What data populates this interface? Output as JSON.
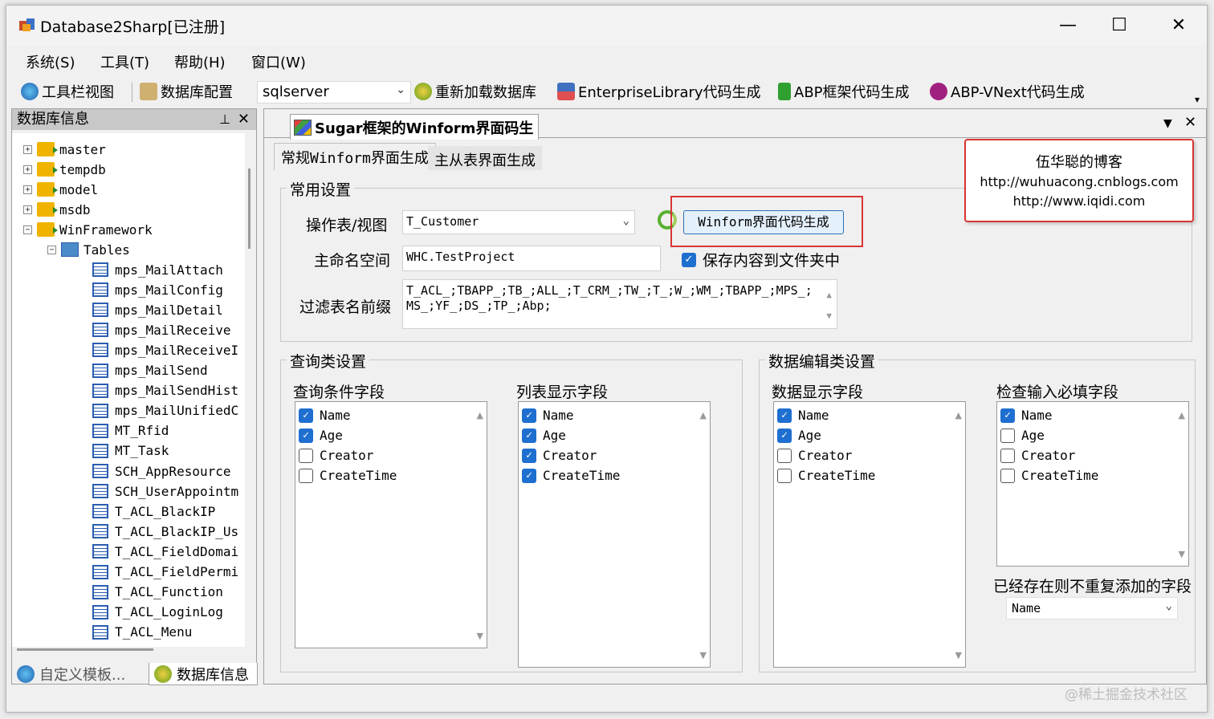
{
  "window": {
    "title": "Database2Sharp[已注册]"
  },
  "menu": [
    "系统(S)",
    "工具(T)",
    "帮助(H)",
    "窗口(W)"
  ],
  "toolbar": {
    "toolbar_view": "工具栏视图",
    "db_config": "数据库配置",
    "db_type": "sqlserver",
    "reload_db": "重新加载数据库",
    "enterprise_lib": "EnterpriseLibrary代码生成",
    "abp_gen": "ABP框架代码生成",
    "abp_vnext_gen": "ABP-VNext代码生成"
  },
  "left_panel": {
    "title": "数据库信息",
    "tree": {
      "databases": [
        "master",
        "tempdb",
        "model",
        "msdb",
        "WinFramework"
      ],
      "tables_node": "Tables",
      "tables": [
        "mps_MailAttach",
        "mps_MailConfig",
        "mps_MailDetail",
        "mps_MailReceive",
        "mps_MailReceiveI",
        "mps_MailSend",
        "mps_MailSendHist",
        "mps_MailUnifiedC",
        "MT_Rfid",
        "MT_Task",
        "SCH_AppResource",
        "SCH_UserAppointm",
        "T_ACL_BlackIP",
        "T_ACL_BlackIP_Us",
        "T_ACL_FieldDomai",
        "T_ACL_FieldPermi",
        "T_ACL_Function",
        "T_ACL_LoginLog",
        "T_ACL_Menu"
      ]
    },
    "tabs": [
      "自定义模板...",
      "数据库信息"
    ]
  },
  "doc": {
    "tab_title": "Sugar框架的Winform界面码生",
    "inner_tabs": [
      "常规Winform界面生成",
      "主从表界面生成"
    ],
    "common_settings": {
      "title": "常用设置",
      "table_label": "操作表/视图",
      "table_value": "T_Customer",
      "generate_button": "Winform界面代码生成",
      "namespace_label": "主命名空间",
      "namespace_value": "WHC.TestProject",
      "save_to_folder": "保存内容到文件夹中",
      "save_to_folder_checked": true,
      "filter_label": "过滤表名前缀",
      "filter_value": "T_ACL_;TBAPP_;TB_;ALL_;T_CRM_;TW_;T_;W_;WM_;TBAPP_;MPS_;MS_;YF_;DS_;TP_;Abp;"
    },
    "query_settings": {
      "title": "查询类设置",
      "condition_fields": {
        "label": "查询条件字段",
        "items": [
          {
            "name": "Name",
            "checked": true
          },
          {
            "name": "Age",
            "checked": true
          },
          {
            "name": "Creator",
            "checked": false
          },
          {
            "name": "CreateTime",
            "checked": false
          }
        ]
      },
      "list_fields": {
        "label": "列表显示字段",
        "items": [
          {
            "name": "Name",
            "checked": true
          },
          {
            "name": "Age",
            "checked": true
          },
          {
            "name": "Creator",
            "checked": true
          },
          {
            "name": "CreateTime",
            "checked": true
          }
        ]
      }
    },
    "edit_settings": {
      "title": "数据编辑类设置",
      "display_fields": {
        "label": "数据显示字段",
        "items": [
          {
            "name": "Name",
            "checked": true
          },
          {
            "name": "Age",
            "checked": true
          },
          {
            "name": "Creator",
            "checked": false
          },
          {
            "name": "CreateTime",
            "checked": false
          }
        ]
      },
      "required_fields": {
        "label": "检查输入必填字段",
        "items": [
          {
            "name": "Name",
            "checked": true
          },
          {
            "name": "Age",
            "checked": false
          },
          {
            "name": "Creator",
            "checked": false
          },
          {
            "name": "CreateTime",
            "checked": false
          }
        ]
      },
      "no_duplicate_label": "已经存在则不重复添加的字段",
      "no_duplicate_value": "Name"
    }
  },
  "note": {
    "title": "伍华聪的博客",
    "line1": "http://wuhuacong.cnblogs.com",
    "line2": "http://www.iqidi.com"
  },
  "watermark": "@稀土掘金技术社区",
  "colors": {
    "accent": "#1e6fd0",
    "highlight_border": "#d93434"
  }
}
